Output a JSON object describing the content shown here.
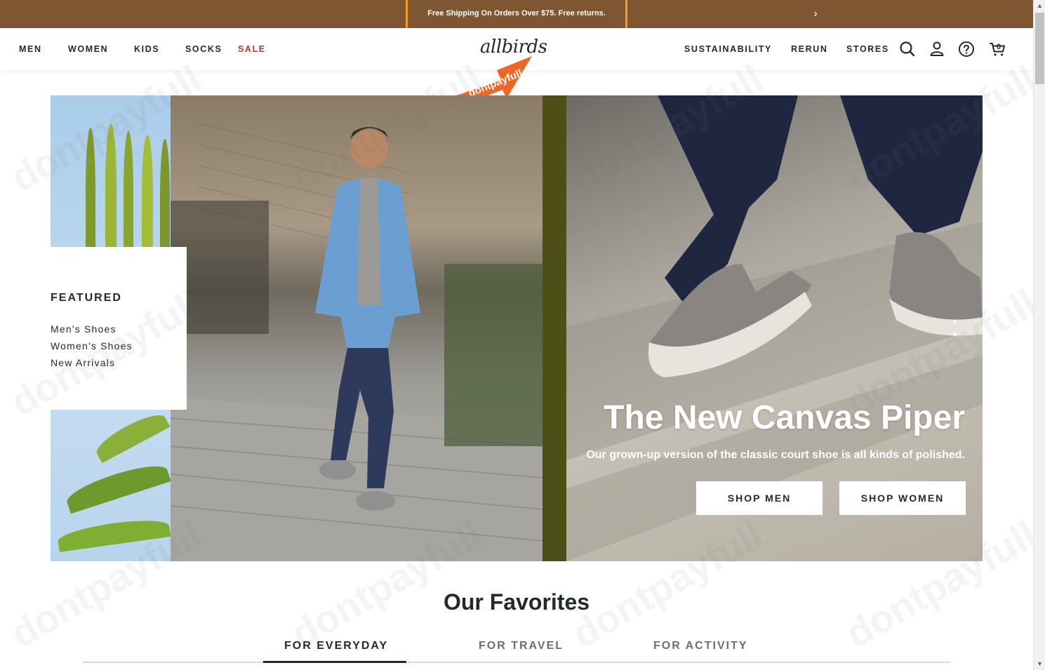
{
  "promo": {
    "text": "Free Shipping On Orders Over $75. Free returns.",
    "next_icon": "chevron-right-icon"
  },
  "nav": {
    "left": [
      {
        "label": "MEN"
      },
      {
        "label": "WOMEN"
      },
      {
        "label": "KIDS"
      },
      {
        "label": "SOCKS"
      },
      {
        "label": "SALE"
      }
    ],
    "logo": "allbirds",
    "right": [
      {
        "label": "SUSTAINABILITY"
      },
      {
        "label": "RERUN"
      },
      {
        "label": "STORES"
      }
    ],
    "icons": [
      "search-icon",
      "account-icon",
      "help-icon",
      "cart-icon"
    ],
    "cart_count": "0"
  },
  "watermark": {
    "text": "dontpayfull"
  },
  "hero": {
    "featured_title": "FEATURED",
    "featured_links": [
      "Men's Shoes",
      "Women's Shoes",
      "New Arrivals"
    ],
    "title": "The New Canvas Piper",
    "subtitle": "Our grown-up version of the classic court shoe is all kinds of polished.",
    "buttons": [
      "SHOP MEN",
      "SHOP WOMEN"
    ],
    "slide_count": 2,
    "active_slide": 2
  },
  "favorites": {
    "title": "Our Favorites",
    "tabs": [
      "FOR EVERYDAY",
      "FOR TRAVEL",
      "FOR ACTIVITY"
    ],
    "active_tab": 0
  },
  "colors": {
    "promo_bg": "#7e5631",
    "sale": "#b33a26",
    "text": "#212a2f",
    "highlight": "#f59a23",
    "watermark_arrow": "#f26522"
  }
}
